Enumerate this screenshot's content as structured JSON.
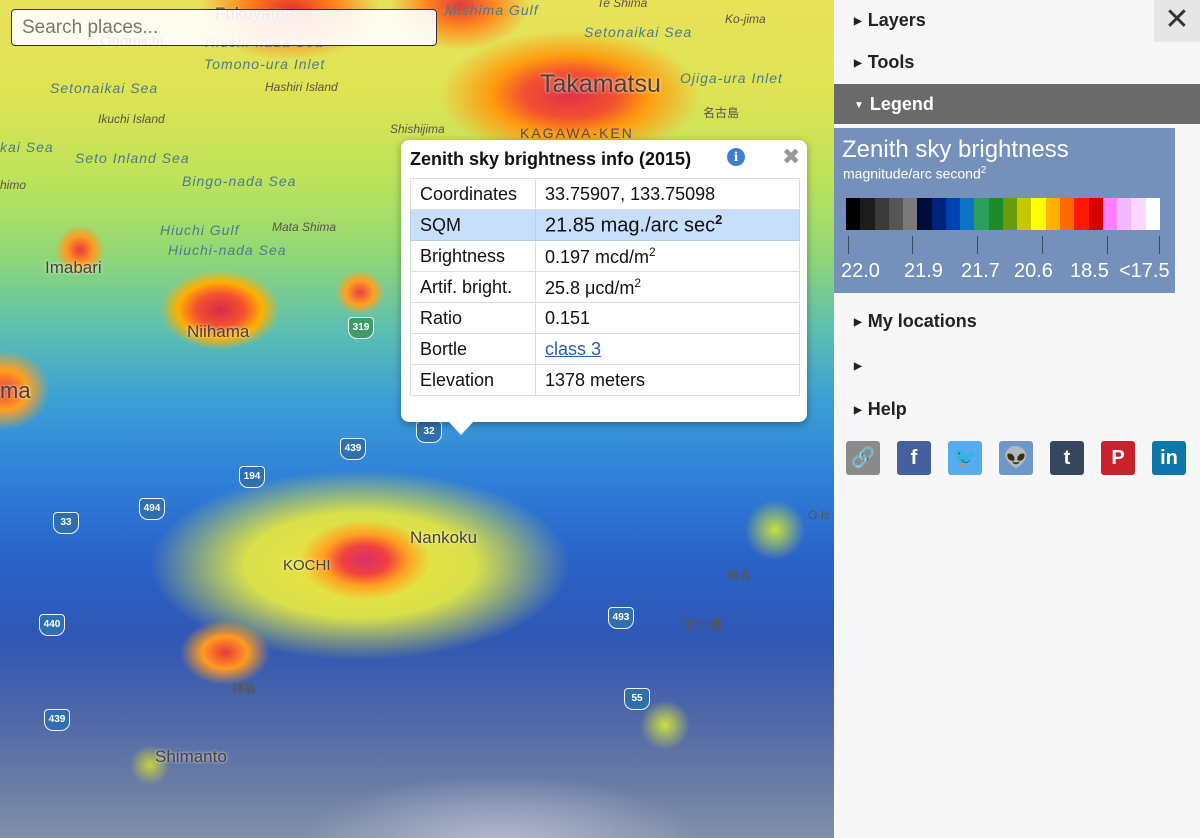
{
  "search": {
    "placeholder": "Search places..."
  },
  "map": {
    "cities": {
      "fukuyama": "Fukuyama",
      "onomichi": "Onomichi",
      "takamatsu": "Takamatsu",
      "imabari": "Imabari",
      "niihama": "Niihama",
      "nankoku": "Nankoku",
      "kochi": "KOCHI",
      "shimanto": "Shimanto",
      "ma": "ma"
    },
    "seas": {
      "tomono_ura": "Tomono-ura Inlet",
      "setonaikai_left": "Setonaikai Sea",
      "setonaikai_right": "Setonaikai Sea",
      "ojiga": "Ojiga-ura Inlet",
      "ikuchi": "Ikuchi Island",
      "hashiri": "Hashiri Island",
      "kai": "kai Sea",
      "seto_inland": "Seto Inland Sea",
      "bingo": "Bingo-nada Sea",
      "hiuchi_gulf": "Hiuchi Gulf",
      "hiuchi_nada": "Hiuchi-nada Sea",
      "mata": "Mata Shima",
      "mishima": "Mishima Gulf",
      "hiuchi_top": "Hiuchi-nada Sea",
      "shimo": "himo",
      "o_is": "O Is"
    },
    "misc": {
      "kagawa": "KAGAWA-KEN",
      "shishijima": "Shishijima",
      "nagoya_jp": "名古島",
      "yodogase": "淀ケ礁",
      "ashima": "鵜島",
      "kamijima": "神島",
      "teshima": "Te Shima",
      "kojima": "Ko-jima"
    },
    "routes": [
      "319",
      "439",
      "32",
      "194",
      "494",
      "33",
      "440",
      "493",
      "55",
      "439"
    ]
  },
  "popup": {
    "title": "Zenith sky brightness info (2015)",
    "info_icon": "i",
    "close_icon": "✖",
    "rows": [
      {
        "key": "Coordinates",
        "value": "33.75907, 133.75098"
      },
      {
        "key": "SQM",
        "value": "21.85 mag./arc sec",
        "sup": "2"
      },
      {
        "key": "Brightness",
        "value": "0.197 mcd/m",
        "sup": "2"
      },
      {
        "key": "Artif. bright.",
        "value": "25.8 μcd/m",
        "sup": "2"
      },
      {
        "key": "Ratio",
        "value": "0.151"
      },
      {
        "key": "Bortle",
        "value": "class 3"
      },
      {
        "key": "Elevation",
        "value": "1378 meters"
      }
    ]
  },
  "sidebar": {
    "close_icon": "✕",
    "sections": {
      "layers": "Layers",
      "tools": "Tools",
      "legend": "Legend",
      "my_locations": "My locations",
      "unnamed": "",
      "help": "Help"
    },
    "legend": {
      "title": "Zenith sky brightness",
      "subtitle": "magnitude/arc second",
      "subtitle_sup": "2",
      "colors": [
        "#000000",
        "#1c1c1c",
        "#3a3a3a",
        "#555555",
        "#7a7a7a",
        "#000b3a",
        "#00237a",
        "#0041b0",
        "#0b74c8",
        "#2c9f5e",
        "#1e8a2b",
        "#6a9a10",
        "#c8c800",
        "#ffff00",
        "#ffb000",
        "#ff6a00",
        "#ff1800",
        "#d50000",
        "#ff80ff",
        "#f2b8ff",
        "#fad8ff",
        "#ffffff"
      ],
      "labels": [
        "22.0",
        "21.9",
        "21.7",
        "20.6",
        "18.5",
        "<17.5"
      ]
    },
    "social": [
      {
        "name": "link",
        "glyph": "🔗",
        "color": "#8a8a8a"
      },
      {
        "name": "facebook",
        "glyph": "f",
        "color": "#45619d"
      },
      {
        "name": "twitter",
        "glyph": "🐦",
        "color": "#55acee"
      },
      {
        "name": "reddit",
        "glyph": "👽",
        "color": "#6f98c9"
      },
      {
        "name": "tumblr",
        "glyph": "t",
        "color": "#36465d"
      },
      {
        "name": "pinterest",
        "glyph": "P",
        "color": "#c8232c"
      },
      {
        "name": "linkedin",
        "glyph": "in",
        "color": "#0e76a8"
      }
    ]
  }
}
